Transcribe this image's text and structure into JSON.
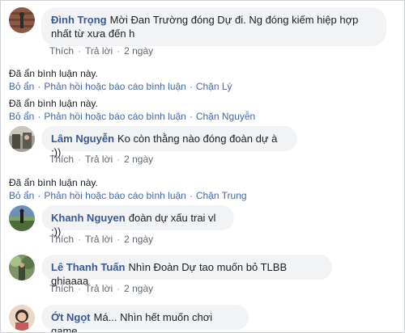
{
  "comments": [
    {
      "author": "Đình Trọng",
      "text_line1": "Mời Đan Trường đóng Dự đi. Ng đóng kiếm hiệp hợp",
      "text_line2": "nhất từ xưa đến h",
      "like": "Thích",
      "reply": "Trả lời",
      "time": "2 ngày"
    },
    {
      "author": "Lâm Nguyễn",
      "text": "Ko còn thằng nào đóng đoàn dự à :))",
      "like": "Thích",
      "reply": "Trả lời",
      "time": "2 ngày"
    },
    {
      "author": "Khanh Nguyen",
      "text": "đoàn dự xấu trai vl :))",
      "like": "Thích",
      "reply": "Trả lời",
      "time": "2 ngày"
    },
    {
      "author": "Lê Thanh Tuấn",
      "text": "Nhìn Đoàn Dự tao muốn bỏ TLBB ghiaaaa",
      "like": "Thích",
      "reply": "Trả lời",
      "time": "2 ngày"
    },
    {
      "author": "Ớt Ngọt",
      "text": "Má... Nhìn hết muốn chơi game"
    }
  ],
  "hidden": [
    {
      "message": "Đã ẩn bình luận này.",
      "unhide": "Bỏ ẩn",
      "report": "Phản hồi hoặc báo cáo bình luận",
      "block": "Chặn Lý"
    },
    {
      "message": "Đã ẩn bình luận này.",
      "unhide": "Bỏ ẩn",
      "report": "Phản hồi hoặc báo cáo bình luận",
      "block": "Chặn Nguyễn"
    },
    {
      "message": "Đã ẩn bình luận này.",
      "unhide": "Bỏ ẩn",
      "report": "Phản hồi hoặc báo cáo bình luận",
      "block": "Chặn Trung"
    }
  ],
  "dot": "·",
  "colors": {
    "name": "#385898",
    "link": "#4267b2",
    "bubble": "#f2f3f5",
    "meta": "#606770"
  }
}
